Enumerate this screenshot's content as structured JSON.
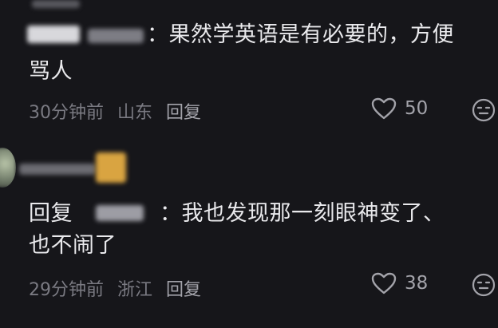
{
  "comments": [
    {
      "text_line1": "：果然学英语是有必要的，方便",
      "text_line2": "骂人",
      "time": "30分钟前",
      "location": "山东",
      "reply_label": "回复",
      "likes": "50",
      "like_icon": "heart-outline-icon",
      "emoji_icon": "smiley-face-icon"
    },
    {
      "reply_prefix": "回复",
      "text_line1": "：我也发现那一刻眼神变了、",
      "text_line2": "也不闹了",
      "time": "29分钟前",
      "location": "浙江",
      "reply_label": "回复",
      "likes": "38",
      "like_icon": "heart-outline-icon",
      "emoji_icon": "smiley-face-icon"
    }
  ],
  "colors": {
    "background": "#16161a",
    "text_primary": "#e9e9ec",
    "text_meta": "#7a7a82",
    "icon": "#a3a3aa"
  }
}
